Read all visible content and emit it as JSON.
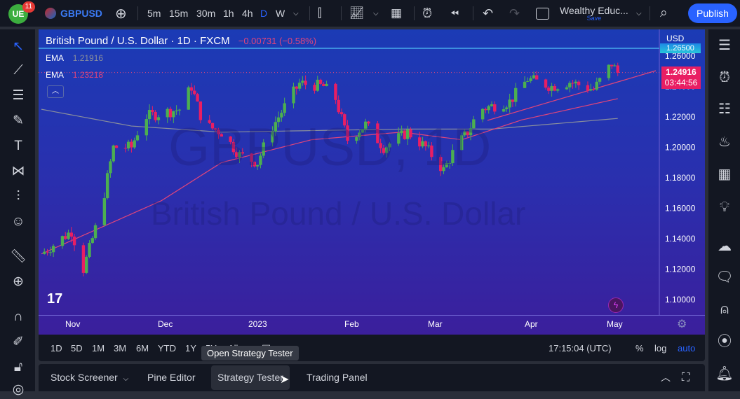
{
  "topbar": {
    "notif_count": "11",
    "symbol": "GBPUSD",
    "intervals": [
      "5m",
      "15m",
      "30m",
      "1h",
      "4h",
      "D",
      "W"
    ],
    "active_interval": "D",
    "layout_name": "Wealthy Educ...",
    "save_label": "Save",
    "publish_label": "Publish"
  },
  "legend": {
    "title": "British Pound / U.S. Dollar · 1D · FXCM",
    "change": "−0.00731 (−0.58%)",
    "ema1_label": "EMA",
    "ema1_value": "1.21916",
    "ema2_label": "EMA",
    "ema2_value": "1.23218"
  },
  "watermark": {
    "line1": "GBPUSD, 1D",
    "line2": "British Pound / U.S. Dollar"
  },
  "price_axis": {
    "currency": "USD",
    "alert_price": "1.26500",
    "last_price": "1.24916",
    "countdown": "03:44:56"
  },
  "colors": {
    "up": "#4caf50",
    "down": "#e91e63",
    "ema_slow": "#8a8f9c",
    "ema_fast": "#e0457b",
    "accent": "#2962ff"
  },
  "chart_data": {
    "type": "candlestick",
    "title": "British Pound / U.S. Dollar · 1D · FXCM",
    "ylim": [
      1.09,
      1.272
    ],
    "y_ticks": [
      "1.26000",
      "1.24000",
      "1.22000",
      "1.20000",
      "1.18000",
      "1.16000",
      "1.14000",
      "1.12000",
      "1.10000"
    ],
    "x_ticks": [
      "Nov",
      "Dec",
      "2023",
      "Feb",
      "Mar",
      "Apr",
      "May"
    ],
    "close_path": [
      [
        0,
        1.13
      ],
      [
        10,
        1.145
      ],
      [
        14,
        1.12
      ],
      [
        20,
        1.16
      ],
      [
        24,
        1.2
      ],
      [
        30,
        1.2
      ],
      [
        34,
        1.22
      ],
      [
        46,
        1.225
      ],
      [
        50,
        1.24
      ],
      [
        54,
        1.215
      ],
      [
        60,
        1.21
      ],
      [
        66,
        1.195
      ],
      [
        72,
        1.19
      ],
      [
        76,
        1.21
      ],
      [
        82,
        1.23
      ],
      [
        86,
        1.242
      ],
      [
        94,
        1.24
      ],
      [
        98,
        1.232
      ],
      [
        102,
        1.205
      ],
      [
        108,
        1.215
      ],
      [
        114,
        1.2
      ],
      [
        122,
        1.21
      ],
      [
        128,
        1.2
      ],
      [
        134,
        1.185
      ],
      [
        138,
        1.2
      ],
      [
        142,
        1.21
      ],
      [
        146,
        1.225
      ],
      [
        156,
        1.23
      ],
      [
        162,
        1.245
      ],
      [
        170,
        1.24
      ],
      [
        176,
        1.243
      ],
      [
        184,
        1.238
      ],
      [
        190,
        1.255
      ],
      [
        192,
        1.249
      ]
    ],
    "ema_fast_path": [
      [
        0,
        1.13
      ],
      [
        40,
        1.165
      ],
      [
        60,
        1.19
      ],
      [
        90,
        1.205
      ],
      [
        120,
        1.21
      ],
      [
        140,
        1.205
      ],
      [
        160,
        1.218
      ],
      [
        192,
        1.232
      ]
    ],
    "ema_slow_path": [
      [
        0,
        1.225
      ],
      [
        30,
        1.214
      ],
      [
        60,
        1.21
      ],
      [
        120,
        1.212
      ],
      [
        150,
        1.212
      ],
      [
        192,
        1.219
      ]
    ]
  },
  "time_axis": {
    "labels": [
      "Nov",
      "Dec",
      "2023",
      "Feb",
      "Mar",
      "Apr",
      "May"
    ]
  },
  "range_bar": {
    "ranges": [
      "1D",
      "5D",
      "1M",
      "3M",
      "6M",
      "YTD",
      "1Y",
      "5Y",
      "All"
    ],
    "time": "17:15:04 (UTC)",
    "percent": "%",
    "log": "log",
    "auto": "auto"
  },
  "tooltip": "Open Strategy Tester",
  "bottom_tabs": [
    "Stock Screener",
    "Pine Editor",
    "Strategy Tester",
    "Trading Panel"
  ]
}
